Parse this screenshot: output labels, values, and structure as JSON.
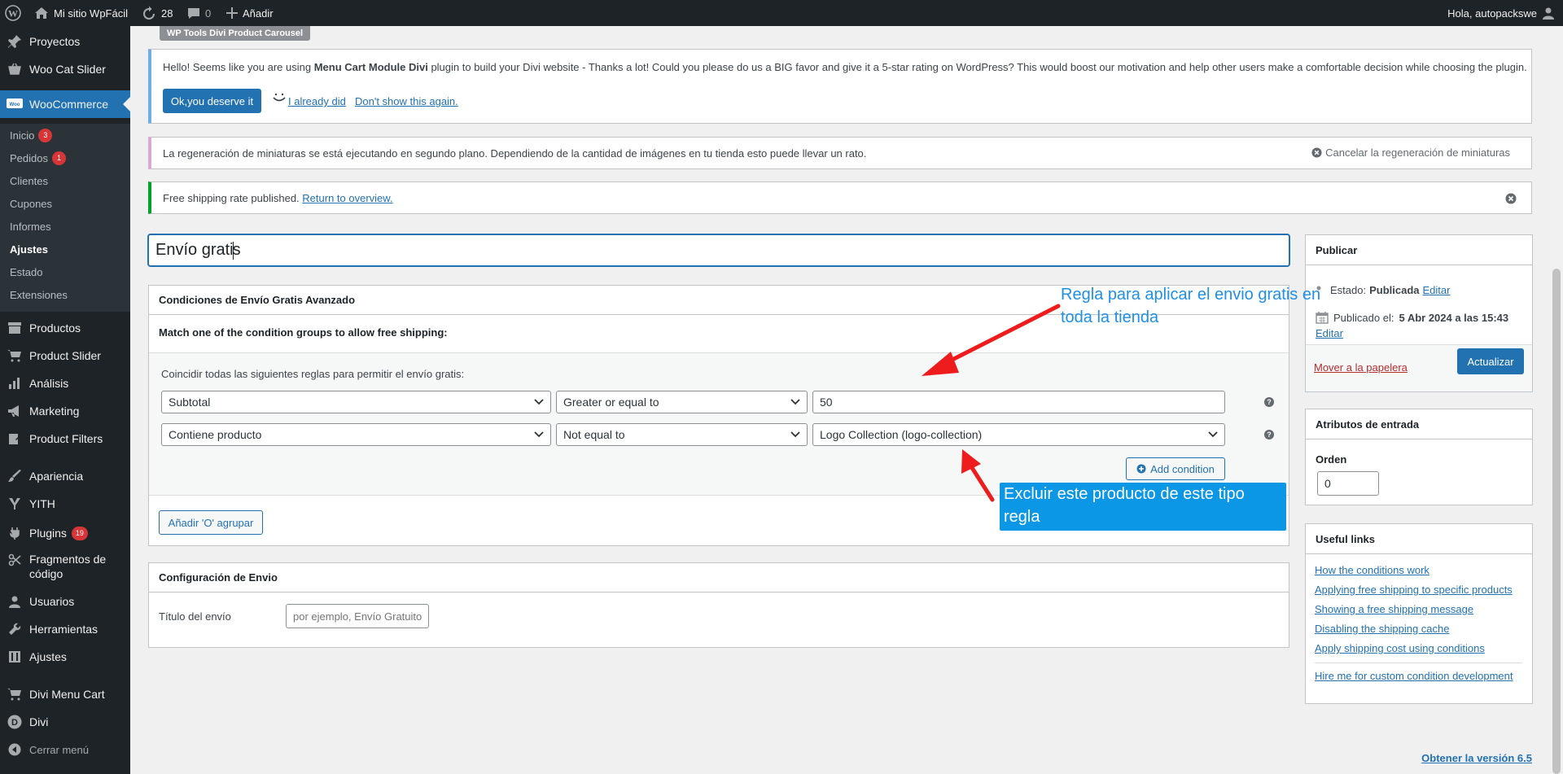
{
  "adminbar": {
    "site_name": "Mi sitio WpFácil",
    "updates_count": "28",
    "comments_count": "0",
    "add_new": "Añadir",
    "greeting": "Hola, autopackswe"
  },
  "sidebar": {
    "items_top": [
      {
        "label": "Proyectos",
        "icon": "pin-icon"
      },
      {
        "label": "Woo Cat Slider",
        "icon": "basket-icon"
      }
    ],
    "current": {
      "label": "WooCommerce",
      "icon": "woo-icon"
    },
    "submenu": [
      {
        "label": "Inicio",
        "badge": "3"
      },
      {
        "label": "Pedidos",
        "badge": "1"
      },
      {
        "label": "Clientes"
      },
      {
        "label": "Cupones"
      },
      {
        "label": "Informes"
      },
      {
        "label": "Ajustes"
      },
      {
        "label": "Estado"
      },
      {
        "label": "Extensiones"
      }
    ],
    "items_bottom": [
      {
        "label": "Productos",
        "icon": "archive-icon"
      },
      {
        "label": "Product Slider",
        "icon": "cart-icon"
      },
      {
        "label": "Análisis",
        "icon": "chart-icon"
      },
      {
        "label": "Marketing",
        "icon": "megaphone-icon"
      },
      {
        "label": "Product Filters",
        "icon": "edit-icon"
      },
      {
        "label": "Apariencia",
        "icon": "brush-icon"
      },
      {
        "label": "YITH",
        "icon": "yith-icon"
      },
      {
        "label": "Plugins",
        "icon": "plug-icon",
        "badge": "19"
      },
      {
        "label": "Fragmentos de código",
        "icon": "scissors-icon"
      },
      {
        "label": "Usuarios",
        "icon": "user-icon"
      },
      {
        "label": "Herramientas",
        "icon": "wrench-icon"
      },
      {
        "label": "Ajustes",
        "icon": "settings-icon"
      },
      {
        "label": "Divi Menu Cart",
        "icon": "cart-icon"
      },
      {
        "label": "Divi",
        "icon": "divi-icon"
      },
      {
        "label": "Cerrar menú",
        "icon": "collapse-icon"
      }
    ]
  },
  "notices": {
    "plugin_tag": "WP Tools Divi Product Carousel",
    "divi_prefix": "Hello! Seems like you are using ",
    "divi_plugin": "Menu Cart Module Divi",
    "divi_suffix": " plugin to build your Divi website - Thanks a lot! Could you please do us a BIG favor and give it a 5-star rating on WordPress? This would boost our motivation and help other users make a comfortable decision while choosing the plugin.",
    "ok_button": "Ok,you deserve it",
    "already_did": "I already did",
    "dont_show": "Don't show this again.",
    "regen_text": "La regeneración de miniaturas se está ejecutando en segundo plano. Dependiendo de la cantidad de imágenes en tu tienda esto puede llevar un rato.",
    "regen_cancel": "Cancelar la regeneración de miniaturas",
    "success_text": "Free shipping rate published.",
    "success_link": "Return to overview."
  },
  "post_title": {
    "before_caret": "Envío grati",
    "after_caret": "s"
  },
  "conditions": {
    "header": "Condiciones de Envío Gratis Avanzado",
    "subheader": "Match one of the condition groups to allow free shipping:",
    "group_label": "Coincidir todas las siguientes reglas para permitir el envío gratis:",
    "rows": [
      {
        "field": "Subtotal",
        "operator": "Greater or equal to",
        "value": "50"
      },
      {
        "field": "Contiene producto",
        "operator": "Not equal to",
        "value": "Logo Collection (logo-collection)"
      }
    ],
    "add_condition": "Add condition",
    "add_or_group": "Añadir 'O' agrupar"
  },
  "shipping_config": {
    "header": "Configuración de Envio",
    "title_label": "Título del envío",
    "title_placeholder": "por ejemplo, Envío Gratuito"
  },
  "publish": {
    "header": "Publicar",
    "status_label": "Estado:",
    "status_value": "Publicada",
    "status_edit": "Editar",
    "published_label": "Publicado el:",
    "published_value": "5 Abr 2024 a las 15:43",
    "published_edit": "Editar",
    "trash": "Mover a la papelera",
    "update": "Actualizar"
  },
  "attributes": {
    "header": "Atributos de entrada",
    "order_label": "Orden",
    "order_value": "0"
  },
  "useful_links": {
    "header": "Useful links",
    "links": [
      "How the conditions work",
      "Applying free shipping to specific products",
      "Showing a free shipping message",
      "Disabling the shipping cache",
      "Apply shipping cost using conditions"
    ],
    "custom_link": "Hire me for custom condition development"
  },
  "annotations": {
    "top": "Regla para aplicar el envio gratis en toda la tienda",
    "bottom": "Excluir este producto de este tipo regla"
  },
  "footer": {
    "version_link": "Obtener la versión 6.5"
  },
  "colors": {
    "accent": "#2271b1",
    "annotation": "#1e90e6",
    "arrow": "#ee1c1c"
  }
}
